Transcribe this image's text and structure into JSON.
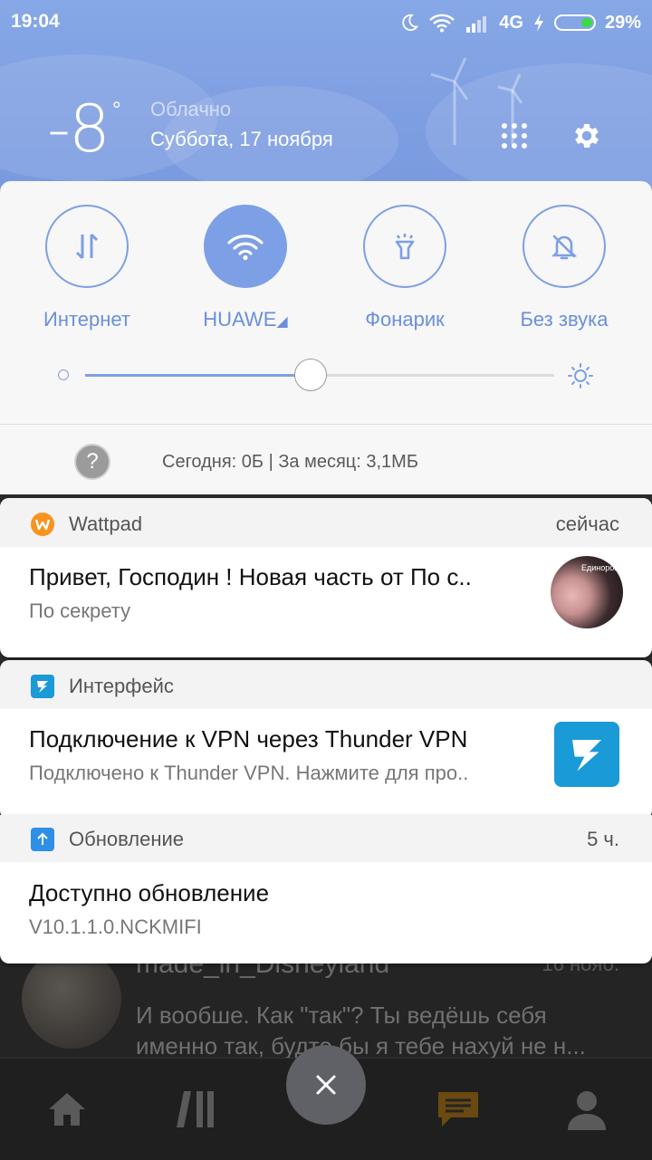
{
  "status_bar": {
    "time": "19:04",
    "network": "4G",
    "battery": "29%",
    "icons": [
      "moon-icon",
      "wifi-icon",
      "signal-icon",
      "charging-icon",
      "battery-icon"
    ]
  },
  "weather": {
    "temperature": "-8",
    "degree": "°",
    "condition": "Облачно",
    "date": "Суббота, 17 ноября"
  },
  "quick_settings": {
    "toggles": [
      {
        "label": "Интернет",
        "icon": "data-transfer-icon",
        "active": false
      },
      {
        "label": "HUAWE",
        "icon": "wifi-icon",
        "active": true
      },
      {
        "label": "Фонарик",
        "icon": "flashlight-icon",
        "active": false
      },
      {
        "label": "Без звука",
        "icon": "bell-off-icon",
        "active": false
      }
    ],
    "brightness_level": 0.48,
    "data_usage": "Сегодня: 0Б  |  За месяц: 3,1МБ"
  },
  "notifications": [
    {
      "app": "Wattpad",
      "time": "сейчас",
      "title": "Привет, Господин ! Новая часть от По с..",
      "body": "По секрету",
      "thumbnail_text": "Единорог",
      "icon_color": "#f7931e"
    },
    {
      "app": "Интерфейс",
      "time": "",
      "title": "Подключение к VPN через Thunder VPN",
      "body": "Подключено к Thunder VPN. Нажмите для про..",
      "icon_color": "#1a9ad6"
    },
    {
      "app": "Обновление",
      "time": "5 ч.",
      "title": "Доступно обновление",
      "body": "V10.1.1.0.NCKMIFI",
      "icon_color": "#2f8fe6"
    }
  ],
  "background_app": {
    "name": "made_in_Disneyland",
    "date": "16 нояб.",
    "message": "И вообше. Как \"так\"? Ты ведёшь себя именно так, будто бы я тебе нахуй не н..."
  },
  "colors": {
    "accent": "#7d9fe5",
    "header": "#809fe2"
  }
}
